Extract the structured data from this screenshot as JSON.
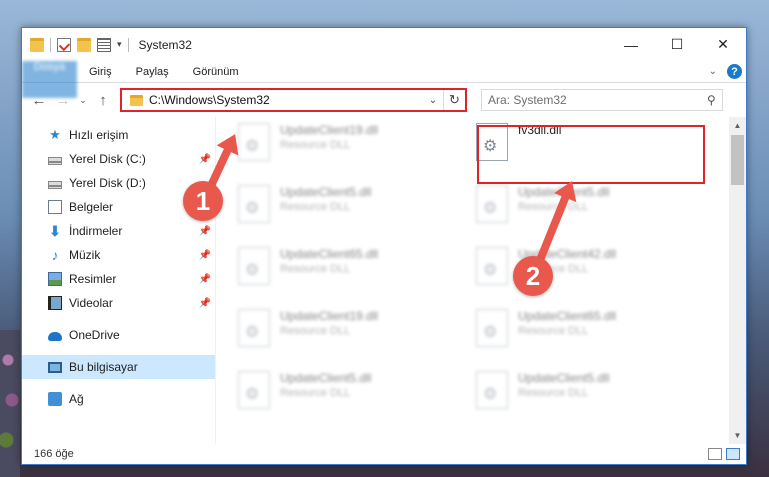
{
  "window": {
    "title": "System32",
    "controls": {
      "minimize": "—",
      "maximize": "☐",
      "close": "✕"
    }
  },
  "ribbon": {
    "tabs": [
      "Dosya",
      "Giriş",
      "Paylaş",
      "Görünüm"
    ],
    "help": "?"
  },
  "address": {
    "path": "C:\\Windows\\System32",
    "search_placeholder": "Ara: System32"
  },
  "sidebar": {
    "items": [
      {
        "label": "Hızlı erişim",
        "icon": "star-icon"
      },
      {
        "label": "Yerel Disk (C:)",
        "icon": "drive-icon",
        "pinned": "📌"
      },
      {
        "label": "Yerel Disk (D:)",
        "icon": "drive-icon"
      },
      {
        "label": "Belgeler",
        "icon": "document-icon"
      },
      {
        "label": "İndirmeler",
        "icon": "download-icon",
        "pinned": "📌"
      },
      {
        "label": "Müzik",
        "icon": "music-icon",
        "pinned": "📌"
      },
      {
        "label": "Resimler",
        "icon": "pictures-icon",
        "pinned": "📌"
      },
      {
        "label": "Videolar",
        "icon": "videos-icon",
        "pinned": "📌"
      },
      {
        "label": "OneDrive",
        "icon": "cloud-icon"
      },
      {
        "label": "Bu bilgisayar",
        "icon": "pc-icon"
      },
      {
        "label": "Ağ",
        "icon": "network-icon"
      }
    ]
  },
  "files": [
    {
      "name": "UpdateClient19.dll",
      "type": "Resource DLL"
    },
    {
      "name": "fv3dll.dll",
      "type": ""
    },
    {
      "name": "UpdateClient5.dll",
      "type": "Resource DLL"
    },
    {
      "name": "UpdateClient5.dll",
      "type": "Resource DLL"
    },
    {
      "name": "UpdateClient65.dll",
      "type": "Resource DLL"
    },
    {
      "name": "UpdateClient42.dll",
      "type": "Resource DLL"
    },
    {
      "name": "UpdateClient19.dll",
      "type": "Resource DLL"
    },
    {
      "name": "UpdateClient65.dll",
      "type": "Resource DLL"
    },
    {
      "name": "UpdateClient5.dll",
      "type": "Resource DLL"
    },
    {
      "name": "UpdateClient5.dll",
      "type": "Resource DLL"
    }
  ],
  "status": {
    "count": "166 öğe"
  },
  "annotations": {
    "badge1": "1",
    "badge2": "2",
    "color": "#e8584d",
    "box_color": "#e0222a"
  }
}
